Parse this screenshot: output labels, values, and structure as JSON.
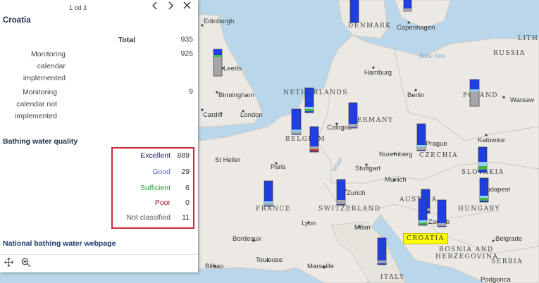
{
  "popup": {
    "pager": "1 od 3",
    "title": "Croatia",
    "rows": [
      {
        "label": "Total",
        "value": "935"
      },
      {
        "label": "Monitoring calendar implemented",
        "value": "926"
      },
      {
        "label": "Monitoring calendar not implemented",
        "value": "9"
      }
    ],
    "quality_heading": "Bathing water quality",
    "quality": [
      {
        "label": "Excellent",
        "value": "889",
        "color": "#1a1a5e"
      },
      {
        "label": "Good",
        "value": "29",
        "color": "#5b6fb3"
      },
      {
        "label": "Sufficient",
        "value": "6",
        "color": "#2e9a2e"
      },
      {
        "label": "Poor",
        "value": "0",
        "color": "#9b1c2e"
      },
      {
        "label": "Not classified",
        "value": "11",
        "color": "#555555"
      }
    ],
    "link": "National bathing water webpage",
    "icons": {
      "prev": "chevron-left-icon",
      "next": "chevron-right-icon",
      "close": "close-icon",
      "dock": "dock-icon",
      "pan": "pan-icon",
      "zoom": "zoom-to-icon"
    }
  },
  "map": {
    "cities": [
      "Edinburgh",
      "Leeds",
      "Birmingham",
      "Cardiff",
      "London",
      "Copenhagen",
      "Hamburg",
      "Berlin",
      "Warsaw",
      "Cologne",
      "Prague",
      "Katowice",
      "Nuremberg",
      "St Helier",
      "Paris",
      "Stuttgart",
      "Munich",
      "Zurich",
      "Budapest",
      "Lyon",
      "Milan",
      "Zagreb",
      "Bordeaux",
      "Toulouse",
      "Marseille",
      "Belgrade",
      "Bilbao",
      "Podgorica"
    ],
    "countries": [
      "DENMARK",
      "RUSSIA",
      "LITH",
      "NETHERLANDS",
      "POLAND",
      "GERMANY",
      "BELGIUM",
      "CZECHIA",
      "SLOVAKIA",
      "FRANCE",
      "SWITZERLAND",
      "AUSTRIA",
      "HUNGARY",
      "BOSNIA AND",
      "HERZEGOVINA",
      "SERBIA",
      "ITALY"
    ],
    "sea": "Baltic Sea",
    "river": "Rhine",
    "highlight": "CROATIA",
    "bar_colors": {
      "excellent": "#1f3fe0",
      "good": "#8fd3f0",
      "sufficient": "#45b545",
      "poor": "#c0392b",
      "not_classified": "#a9a6aa"
    }
  }
}
